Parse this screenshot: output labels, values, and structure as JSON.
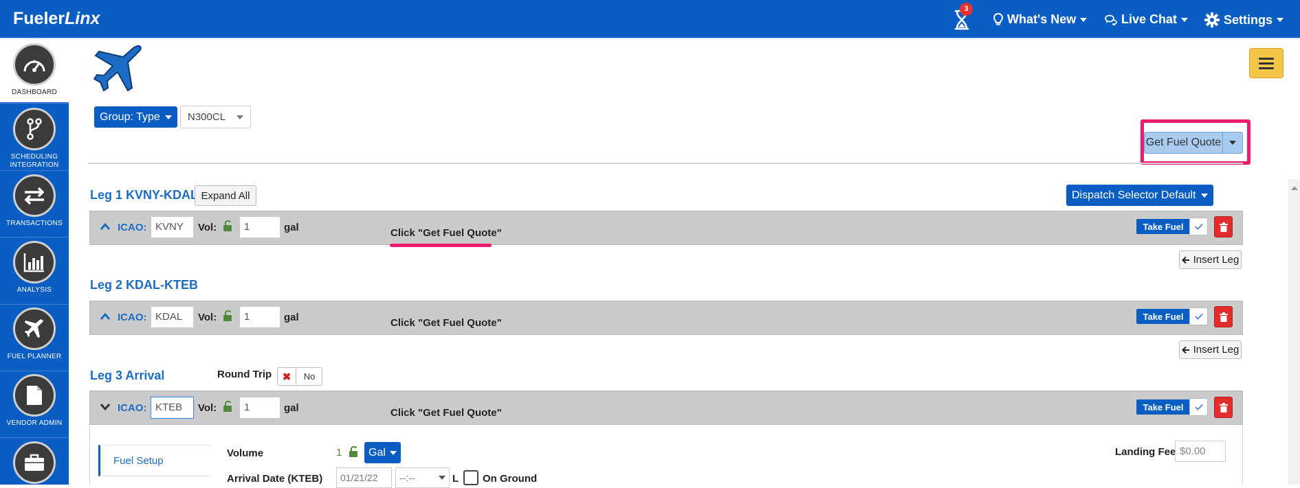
{
  "header": {
    "brand_prefix": "Fueler",
    "brand_suffix": "Linx",
    "notification_count": "3",
    "whats_new": "What's New",
    "live_chat": "Live Chat",
    "settings": "Settings"
  },
  "sidebar": {
    "items": [
      {
        "label": "DASHBOARD",
        "icon": "dashboard-gauge-icon"
      },
      {
        "label": "SCHEDULING INTEGRATION",
        "icon": "branch-icon"
      },
      {
        "label": "TRANSACTIONS",
        "icon": "arrows-exchange-icon"
      },
      {
        "label": "ANALYSIS",
        "icon": "bar-chart-icon"
      },
      {
        "label": "FUEL PLANNER",
        "icon": "plane-icon"
      },
      {
        "label": "VENDOR ADMIN",
        "icon": "document-icon"
      }
    ]
  },
  "toolbar": {
    "group_type": "Group: Type",
    "tail_number": "N300CL",
    "get_fuel_quote": "Get Fuel Quote",
    "dispatch_selector": "Dispatch Selector Default",
    "expand_all": "Expand All"
  },
  "legs": [
    {
      "title": "Leg 1 KVNY-KDAL",
      "icao_label": "ICAO:",
      "icao": "KVNY",
      "vol_label": "Vol:",
      "vol": "1",
      "unit": "gal",
      "note": "Click \"Get Fuel Quote\"",
      "take_fuel": "Take Fuel",
      "insert_leg": "Insert Leg"
    },
    {
      "title": "Leg 2 KDAL-KTEB",
      "icao_label": "ICAO:",
      "icao": "KDAL",
      "vol_label": "Vol:",
      "vol": "1",
      "unit": "gal",
      "note": "Click \"Get Fuel Quote\"",
      "take_fuel": "Take Fuel",
      "insert_leg": "Insert Leg"
    },
    {
      "title": "Leg 3 Arrival",
      "icao_label": "ICAO:",
      "icao": "KTEB",
      "vol_label": "Vol:",
      "vol": "1",
      "unit": "gal",
      "note": "Click \"Get Fuel Quote\"",
      "take_fuel": "Take Fuel"
    }
  ],
  "round_trip": {
    "label": "Round Trip",
    "value": "No"
  },
  "fuel_setup": {
    "tab": "Fuel Setup",
    "volume_label": "Volume",
    "volume_value": "1",
    "unit_select": "Gal",
    "arrival_date_label": "Arrival Date (KTEB)",
    "arrival_date": "01/21/22",
    "arrival_time": "--:--",
    "time_suffix": "L",
    "on_ground": "On Ground",
    "landing_fee_label": "Landing Fee",
    "landing_fee_placeholder": "$0.00"
  },
  "colors": {
    "primary": "#0a5ec3",
    "highlight": "#ef1b6e",
    "danger": "#e32c2c",
    "unlock": "#4f8a3b"
  }
}
